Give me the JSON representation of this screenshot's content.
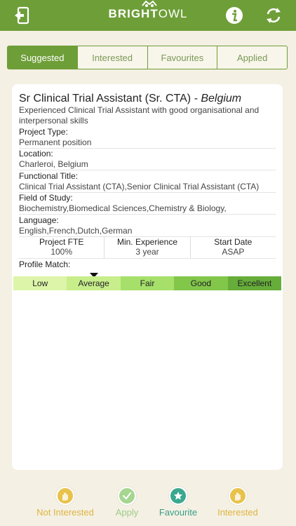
{
  "header": {
    "brand_bold": "BRIGHT",
    "brand_light": "OWL"
  },
  "tabs": [
    {
      "label": "Suggested",
      "active": true
    },
    {
      "label": "Interested",
      "active": false
    },
    {
      "label": "Favourites",
      "active": false
    },
    {
      "label": "Applied",
      "active": false
    }
  ],
  "job": {
    "title": "Sr Clinical Trial Assistant (Sr. CTA)",
    "location_tag": "- Belgium",
    "description": "Experienced Clinical Trial Assistant with good organisational and interpersonal skills",
    "fields": [
      {
        "label": "Project Type:",
        "value": "Permanent position"
      },
      {
        "label": "Location:",
        "value": "Charleroi, Belgium"
      },
      {
        "label": "Functional Title:",
        "value": "Clinical Trial Assistant (CTA),Senior Clinical Trial Assistant (CTA)"
      },
      {
        "label": "Field of Study:",
        "value": "Biochemistry,Biomedical Sciences,Chemistry & Biology,"
      },
      {
        "label": "Language:",
        "value": "English,French,Dutch,German"
      }
    ],
    "stats": [
      {
        "label": "Project FTE",
        "value": "100%"
      },
      {
        "label": "Min. Experience",
        "value": "3 year"
      },
      {
        "label": "Start Date",
        "value": "ASAP"
      }
    ],
    "profile_match_label": "Profile Match:",
    "match_levels": [
      "Low",
      "Average",
      "Fair",
      "Good",
      "Excellent"
    ],
    "match_level_colors": [
      "#dcf5a8",
      "#c8ee8c",
      "#a6e06a",
      "#82c64a",
      "#66ad3a"
    ],
    "current_match": "Average"
  },
  "actions": [
    {
      "label": "Not Interested",
      "icon": "hand-icon",
      "color": "#e8c24a",
      "text_color": "#e0b440"
    },
    {
      "label": "Apply",
      "icon": "check-icon",
      "color": "#a6d690",
      "text_color": "#9ccc86"
    },
    {
      "label": "Favourite",
      "icon": "star-icon",
      "color": "#3aa88e",
      "text_color": "#3a9e86"
    },
    {
      "label": "Interested",
      "icon": "hand-icon",
      "color": "#e8c24a",
      "text_color": "#e0b440"
    }
  ],
  "colors": {
    "brand_green": "#6e9e38",
    "background": "#f4f0e4"
  }
}
